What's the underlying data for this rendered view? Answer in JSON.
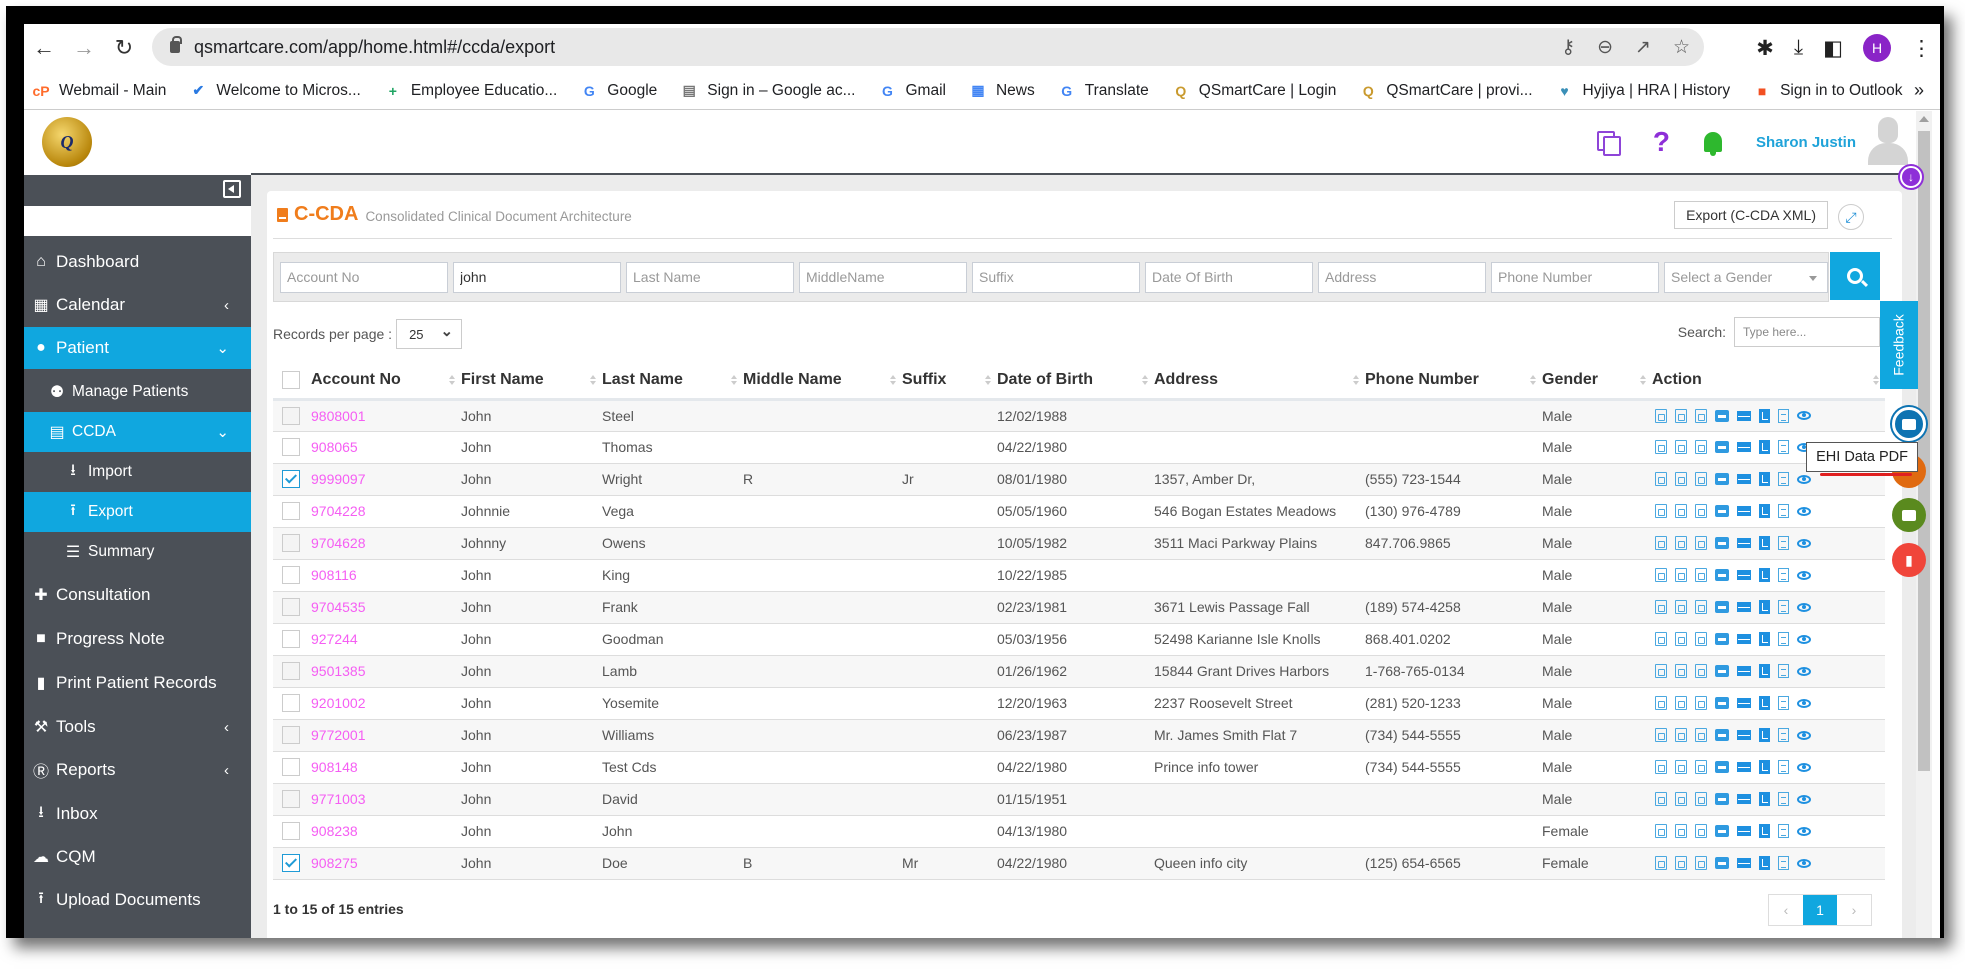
{
  "browser": {
    "url": "qsmartcare.com/app/home.html#/ccda/export",
    "profile_initial": "H",
    "bookmarks": [
      {
        "label": "Webmail - Main",
        "icon": "cpanel-icon",
        "color": "#ff6c2c",
        "glyph": "cP"
      },
      {
        "label": "Welcome to Micros...",
        "icon": "check-icon",
        "color": "#2a7ae2",
        "glyph": "✔"
      },
      {
        "label": "Employee Educatio...",
        "icon": "plus-box-icon",
        "color": "#1fa463",
        "glyph": "+"
      },
      {
        "label": "Google",
        "icon": "google-icon",
        "color": "#4285f4",
        "glyph": "G"
      },
      {
        "label": "Sign in – Google ac...",
        "icon": "google-account-icon",
        "color": "#777",
        "glyph": "▤"
      },
      {
        "label": "Gmail",
        "icon": "google-icon",
        "color": "#4285f4",
        "glyph": "G"
      },
      {
        "label": "News",
        "icon": "news-icon",
        "color": "#4285f4",
        "glyph": "▦"
      },
      {
        "label": "Translate",
        "icon": "translate-icon",
        "color": "#4285f4",
        "glyph": "G"
      },
      {
        "label": "QSmartCare | Login",
        "icon": "qsm-logo-icon",
        "color": "#c99a2e",
        "glyph": "Q"
      },
      {
        "label": "QSmartCare | provi...",
        "icon": "qsm-logo-icon",
        "color": "#c99a2e",
        "glyph": "Q"
      },
      {
        "label": "Hyjiya | HRA | History",
        "icon": "heart-icon",
        "color": "#3a8fb7",
        "glyph": "♥"
      },
      {
        "label": "Sign in to Outlook",
        "icon": "microsoft-icon",
        "color": "#f25022",
        "glyph": "■"
      }
    ],
    "more": "»"
  },
  "header": {
    "user_name": "Sharon Justin",
    "logo_text": "Q"
  },
  "sidebar": {
    "items": [
      {
        "label": "Dashboard",
        "icon": "⌂",
        "icon_name": "home-icon",
        "active": false,
        "chevron": ""
      },
      {
        "label": "Calendar",
        "icon": "▦",
        "icon_name": "calendar-icon",
        "active": false,
        "chevron": "‹"
      },
      {
        "label": "Patient",
        "icon": "●",
        "icon_name": "user-icon",
        "active": true,
        "chevron": "⌄"
      },
      {
        "label": "Manage Patients",
        "icon": "⚉",
        "icon_name": "users-icon",
        "active": false,
        "chevron": "",
        "sub": 1
      },
      {
        "label": "CCDA",
        "icon": "▤",
        "icon_name": "file-code-icon",
        "active": true,
        "chevron": "⌄",
        "sub": 1
      },
      {
        "label": "Import",
        "icon": "⭳",
        "icon_name": "download-icon",
        "active": false,
        "chevron": "",
        "sub": 2
      },
      {
        "label": "Export",
        "icon": "⭱",
        "icon_name": "upload-icon",
        "active": true,
        "chevron": "",
        "sub": 2
      },
      {
        "label": "Summary",
        "icon": "☰",
        "icon_name": "list-icon",
        "active": false,
        "chevron": "",
        "sub": 2
      },
      {
        "label": "Consultation",
        "icon": "✚",
        "icon_name": "medkit-icon",
        "active": false,
        "chevron": ""
      },
      {
        "label": "Progress Note",
        "icon": "■",
        "icon_name": "sticky-note-icon",
        "active": false,
        "chevron": ""
      },
      {
        "label": "Print Patient Records",
        "icon": "▮",
        "icon_name": "file-icon",
        "active": false,
        "chevron": ""
      },
      {
        "label": "Tools",
        "icon": "⚒",
        "icon_name": "wrench-icon",
        "active": false,
        "chevron": "‹"
      },
      {
        "label": "Reports",
        "icon": "Ⓡ",
        "icon_name": "registered-icon",
        "active": false,
        "chevron": "‹"
      },
      {
        "label": "Inbox",
        "icon": "⭳",
        "icon_name": "inbox-icon",
        "active": false,
        "chevron": ""
      },
      {
        "label": "CQM",
        "icon": "☁",
        "icon_name": "cloud-upload-icon",
        "active": false,
        "chevron": ""
      },
      {
        "label": "Upload Documents",
        "icon": "⭱",
        "icon_name": "upload-icon",
        "active": false,
        "chevron": ""
      }
    ]
  },
  "page": {
    "title": "C-CDA",
    "subtitle": "Consolidated Clinical Document Architecture",
    "export_button": "Export (C-CDA XML)",
    "filters": [
      {
        "placeholder": "Account No",
        "value": ""
      },
      {
        "placeholder": "john",
        "value": "john"
      },
      {
        "placeholder": "Last Name",
        "value": ""
      },
      {
        "placeholder": "MiddleName",
        "value": ""
      },
      {
        "placeholder": "Suffix",
        "value": ""
      },
      {
        "placeholder": "Date Of Birth",
        "value": ""
      },
      {
        "placeholder": "Address",
        "value": ""
      },
      {
        "placeholder": "Phone Number",
        "value": ""
      }
    ],
    "gender_select": "Select a Gender",
    "records_per_page_label": "Records per page :",
    "records_per_page": "25",
    "search_label": "Search:",
    "search_placeholder": "Type here...",
    "entries_info": "1 to 15 of 15 entries",
    "pager": {
      "prev": "‹",
      "current": "1",
      "next": "›"
    }
  },
  "table": {
    "columns": [
      "Account No",
      "First Name",
      "Last Name",
      "Middle Name",
      "Suffix",
      "Date of Birth",
      "Address",
      "Phone Number",
      "Gender",
      "Action"
    ],
    "rows": [
      {
        "checked": false,
        "account": "9808001",
        "first": "John",
        "last": "Steel",
        "middle": "",
        "suffix": "",
        "dob": "12/02/1988",
        "address": "",
        "phone": "",
        "gender": "Male"
      },
      {
        "checked": false,
        "account": "908065",
        "first": "John",
        "last": "Thomas",
        "middle": "",
        "suffix": "",
        "dob": "04/22/1980",
        "address": "",
        "phone": "",
        "gender": "Male"
      },
      {
        "checked": true,
        "account": "9999097",
        "first": "John",
        "last": "Wright",
        "middle": "R",
        "suffix": "Jr",
        "dob": "08/01/1980",
        "address": "1357, Amber Dr,",
        "phone": "(555) 723-1544",
        "gender": "Male"
      },
      {
        "checked": false,
        "account": "9704228",
        "first": "Johnnie",
        "last": "Vega",
        "middle": "",
        "suffix": "",
        "dob": "05/05/1960",
        "address": "546 Bogan Estates Meadows",
        "phone": "(130) 976-4789",
        "gender": "Male"
      },
      {
        "checked": false,
        "account": "9704628",
        "first": "Johnny",
        "last": "Owens",
        "middle": "",
        "suffix": "",
        "dob": "10/05/1982",
        "address": "3511 Maci Parkway Plains",
        "phone": "847.706.9865",
        "gender": "Male"
      },
      {
        "checked": false,
        "account": "908116",
        "first": "John",
        "last": "King",
        "middle": "",
        "suffix": "",
        "dob": "10/22/1985",
        "address": "",
        "phone": "",
        "gender": "Male"
      },
      {
        "checked": false,
        "account": "9704535",
        "first": "John",
        "last": "Frank",
        "middle": "",
        "suffix": "",
        "dob": "02/23/1981",
        "address": "3671 Lewis Passage Fall",
        "phone": "(189) 574-4258",
        "gender": "Male"
      },
      {
        "checked": false,
        "account": "927244",
        "first": "John",
        "last": "Goodman",
        "middle": "",
        "suffix": "",
        "dob": "05/03/1956",
        "address": "52498 Karianne Isle Knolls",
        "phone": "868.401.0202",
        "gender": "Male"
      },
      {
        "checked": false,
        "account": "9501385",
        "first": "John",
        "last": "Lamb",
        "middle": "",
        "suffix": "",
        "dob": "01/26/1962",
        "address": "15844 Grant Drives Harbors",
        "phone": "1-768-765-0134",
        "gender": "Male"
      },
      {
        "checked": false,
        "account": "9201002",
        "first": "John",
        "last": "Yosemite",
        "middle": "",
        "suffix": "",
        "dob": "12/20/1963",
        "address": "2237 Roosevelt Street",
        "phone": "(281) 520-1233",
        "gender": "Male"
      },
      {
        "checked": false,
        "account": "9772001",
        "first": "John",
        "last": "Williams",
        "middle": "",
        "suffix": "",
        "dob": "06/23/1987",
        "address": "Mr. James Smith Flat 7",
        "phone": "(734) 544-5555",
        "gender": "Male"
      },
      {
        "checked": false,
        "account": "908148",
        "first": "John",
        "last": "Test Cds",
        "middle": "",
        "suffix": "",
        "dob": "04/22/1980",
        "address": "Prince info tower",
        "phone": "(734) 544-5555",
        "gender": "Male"
      },
      {
        "checked": false,
        "account": "9771003",
        "first": "John",
        "last": "David",
        "middle": "",
        "suffix": "",
        "dob": "01/15/1951",
        "address": "",
        "phone": "",
        "gender": "Male"
      },
      {
        "checked": false,
        "account": "908238",
        "first": "John",
        "last": "John",
        "middle": "",
        "suffix": "",
        "dob": "04/13/1980",
        "address": "",
        "phone": "",
        "gender": "Female"
      },
      {
        "checked": true,
        "account": "908275",
        "first": "John",
        "last": "Doe",
        "middle": "B",
        "suffix": "Mr",
        "dob": "04/22/1980",
        "address": "Queen info city",
        "phone": "(125) 654-6565",
        "gender": "Female"
      }
    ],
    "action_icons": [
      "ccda-xml-icon",
      "ccda-xml-icon",
      "ccda-xml-icon",
      "print-icon",
      "email-icon",
      "pdf-icon",
      "file-text-icon",
      "view-icon"
    ]
  },
  "floating": {
    "feedback_label": "Feedback",
    "tooltip": "EHI Data PDF"
  },
  "colors": {
    "accent": "#10a7df",
    "sidebar_bg": "#4b5057",
    "title_orange": "#f07d1c",
    "account_link": "#f55ef3"
  }
}
